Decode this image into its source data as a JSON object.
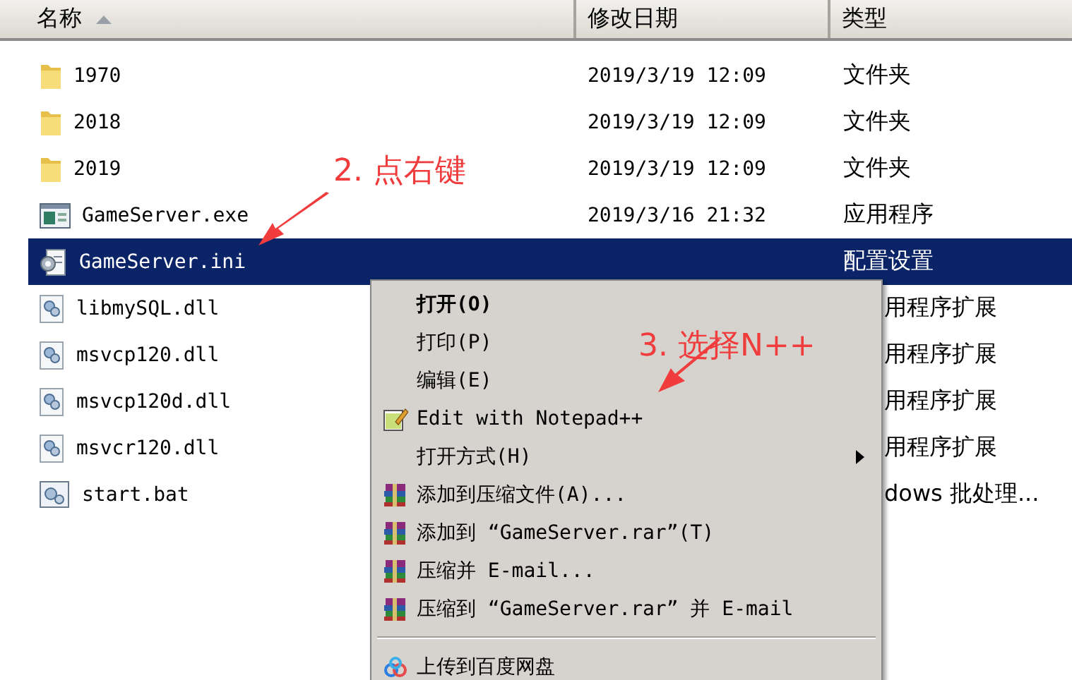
{
  "columns": [
    {
      "label": "名称",
      "sorted": true
    },
    {
      "label": "修改日期",
      "sorted": false
    },
    {
      "label": "类型",
      "sorted": false
    }
  ],
  "rows": [
    {
      "kind": "folder",
      "name": "1970",
      "date": "2019/3/19 12:09",
      "type": "文件夹",
      "selected": false,
      "covered": false
    },
    {
      "kind": "folder",
      "name": "2018",
      "date": "2019/3/19 12:09",
      "type": "文件夹",
      "selected": false,
      "covered": false
    },
    {
      "kind": "folder",
      "name": "2019",
      "date": "2019/3/19 12:09",
      "type": "文件夹",
      "selected": false,
      "covered": false
    },
    {
      "kind": "exe",
      "name": "GameServer.exe",
      "date": "2019/3/16 21:32",
      "type": "应用程序",
      "selected": false,
      "covered": false
    },
    {
      "kind": "ini",
      "name": "GameServer.ini",
      "type": "配置设置",
      "selected": true,
      "covered": false
    },
    {
      "kind": "dll",
      "name": "libmySQL.dll",
      "type": "用程序扩展",
      "selected": false,
      "covered": true
    },
    {
      "kind": "dll",
      "name": "msvcp120.dll",
      "type": "用程序扩展",
      "selected": false,
      "covered": true
    },
    {
      "kind": "dll",
      "name": "msvcp120d.dll",
      "type": "用程序扩展",
      "selected": false,
      "covered": true
    },
    {
      "kind": "dll",
      "name": "msvcr120.dll",
      "type": "用程序扩展",
      "selected": false,
      "covered": true
    },
    {
      "kind": "bat",
      "name": "start.bat",
      "type": "dows 批处理...",
      "selected": false,
      "covered": true
    }
  ],
  "menu": [
    {
      "kind": "plain",
      "label": "打开(O)",
      "bold": true,
      "submenu": false
    },
    {
      "kind": "plain",
      "label": "打印(P)",
      "bold": false,
      "submenu": false
    },
    {
      "kind": "plain",
      "label": "编辑(E)",
      "bold": false,
      "submenu": false
    },
    {
      "kind": "notepad",
      "label": "Edit with Notepad++",
      "bold": false,
      "submenu": false
    },
    {
      "kind": "plain",
      "label": "打开方式(H)",
      "bold": false,
      "submenu": true
    },
    {
      "kind": "archive",
      "label": "添加到压缩文件(A)...",
      "bold": false,
      "submenu": false
    },
    {
      "kind": "archive",
      "label": "添加到 “GameServer.rar”(T)",
      "bold": false,
      "submenu": false
    },
    {
      "kind": "archive",
      "label": "压缩并 E-mail...",
      "bold": false,
      "submenu": false
    },
    {
      "kind": "archive",
      "label": "压缩到 “GameServer.rar” 并 E-mail",
      "bold": false,
      "submenu": false
    },
    {
      "kind": "separator"
    },
    {
      "kind": "upload",
      "label": "上传到百度网盘",
      "bold": false,
      "submenu": false
    }
  ],
  "annotations": [
    {
      "kind": "step2",
      "text": "2. 点右键"
    },
    {
      "kind": "step3",
      "text": "3. 选择N++"
    }
  ]
}
